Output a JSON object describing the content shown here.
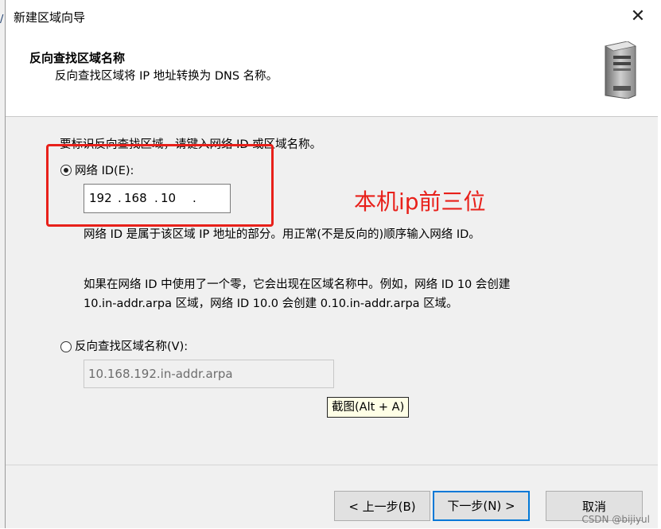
{
  "window": {
    "title": "新建区域向导",
    "close_glyph": "✕"
  },
  "header": {
    "title": "反向查找区域名称",
    "subtitle": "反向查找区域将 IP 地址转换为 DNS 名称。",
    "icon": "server-icon"
  },
  "instruction": "要标识反向查找区域，请键入网络 ID 或区域名称。",
  "network_id": {
    "label": "网络 ID(E):",
    "selected": true,
    "octets": [
      "192",
      "168",
      "10",
      ""
    ],
    "description": "网络 ID 是属于该区域 IP 地址的部分。用正常(不是反向的)顺序输入网络 ID。",
    "note_line1": "如果在网络 ID 中使用了一个零，它会出现在区域名称中。例如，网络 ID 10 会创建",
    "note_line2": "10.in-addr.arpa 区域，网络 ID 10.0 会创建 0.10.in-addr.arpa 区域。"
  },
  "zone_name": {
    "label": "反向查找区域名称(V):",
    "selected": false,
    "value": "10.168.192.in-addr.arpa"
  },
  "annotation": {
    "text": "本机ip前三位",
    "color": "#e8201a"
  },
  "tooltip": "截图(Alt + A)",
  "buttons": {
    "back": "< 上一步(B)",
    "next": "下一步(N) >",
    "cancel": "取消"
  },
  "watermark": "CSDN @bijiyul",
  "accent_color": "#0078d7"
}
